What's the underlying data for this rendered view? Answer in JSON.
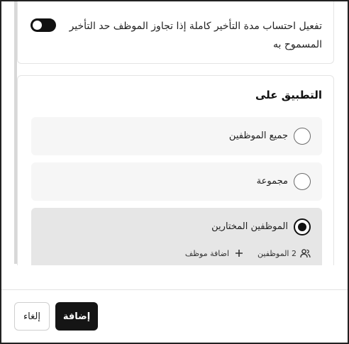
{
  "toggle_card": {
    "label": "تفعيل احتساب مدة التأخير كاملة إذا تجاوز الموظف حد التأخير المسموح به",
    "toggle_state": "off"
  },
  "apply_section": {
    "title": "التطبيق على",
    "options": [
      {
        "label": "جميع الموظفين",
        "selected": false
      },
      {
        "label": "مجموعة",
        "selected": false
      },
      {
        "label": "الموظفين المختارين",
        "selected": true
      }
    ],
    "selected_meta": {
      "employee_count_label": "2 الموظفين",
      "add_employee_label": "اضافة موظف"
    }
  },
  "footer": {
    "add_label": "إضافة",
    "cancel_label": "إلغاء"
  },
  "colors": {
    "accent": "#151515",
    "selected_option_bg": "#e6e6e6",
    "option_bg": "#f6f6f6"
  }
}
